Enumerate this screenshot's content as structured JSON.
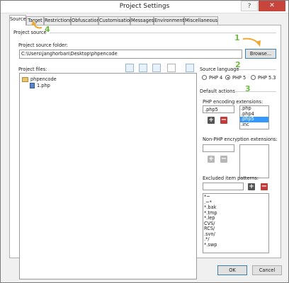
{
  "window": {
    "title": "Project Settings",
    "help_label": "?",
    "close_label": "✕"
  },
  "tabs": [
    {
      "label": "Source",
      "active": true
    },
    {
      "label": "Target"
    },
    {
      "label": "Restrictions"
    },
    {
      "label": "Obfuscation"
    },
    {
      "label": "Customisation"
    },
    {
      "label": "Messages"
    },
    {
      "label": "Environment"
    },
    {
      "label": "Miscellaneous"
    }
  ],
  "source": {
    "group_label": "Project source",
    "folder_label": "Project source folder:",
    "folder_value": "C:\\Users\\janghorban\\Desktop\\phpencode",
    "browse_label": "Browse...",
    "files_label": "Project files:",
    "tree": {
      "root": "phpencode",
      "child": "1.php"
    }
  },
  "language": {
    "label": "Source language",
    "options": [
      {
        "label": "PHP 4",
        "selected": false
      },
      {
        "label": "PHP 5",
        "selected": true
      },
      {
        "label": "PHP 5.3",
        "selected": false
      }
    ]
  },
  "default_actions": {
    "label": "Default actions",
    "php_ext_label": "PHP encoding extensions:",
    "php_ext_input": ".php5",
    "php_ext_list": [
      ".php",
      ".php4",
      ".php5",
      ".inc"
    ],
    "php_ext_selected": ".php5",
    "nonphp_label": "Non-PHP encryption extensions:",
    "nonphp_input": "",
    "excluded_label": "Excluded item patterns:",
    "excluded_input": "",
    "excluded_list": [
      "*~",
      ".~*",
      "*.bak",
      "*.tmp",
      "*.lep",
      "CVS/",
      "RCS/",
      ".svn/",
      ".*/",
      "*.swp"
    ]
  },
  "buttons": {
    "add": "+",
    "remove": "−",
    "ok": "OK",
    "cancel": "Cancel"
  },
  "annotations": {
    "step1": "1",
    "step2": "2",
    "step3": "3",
    "step4": "4",
    "accent_color": "#f0a830",
    "number_color": "#6cbd3f"
  }
}
